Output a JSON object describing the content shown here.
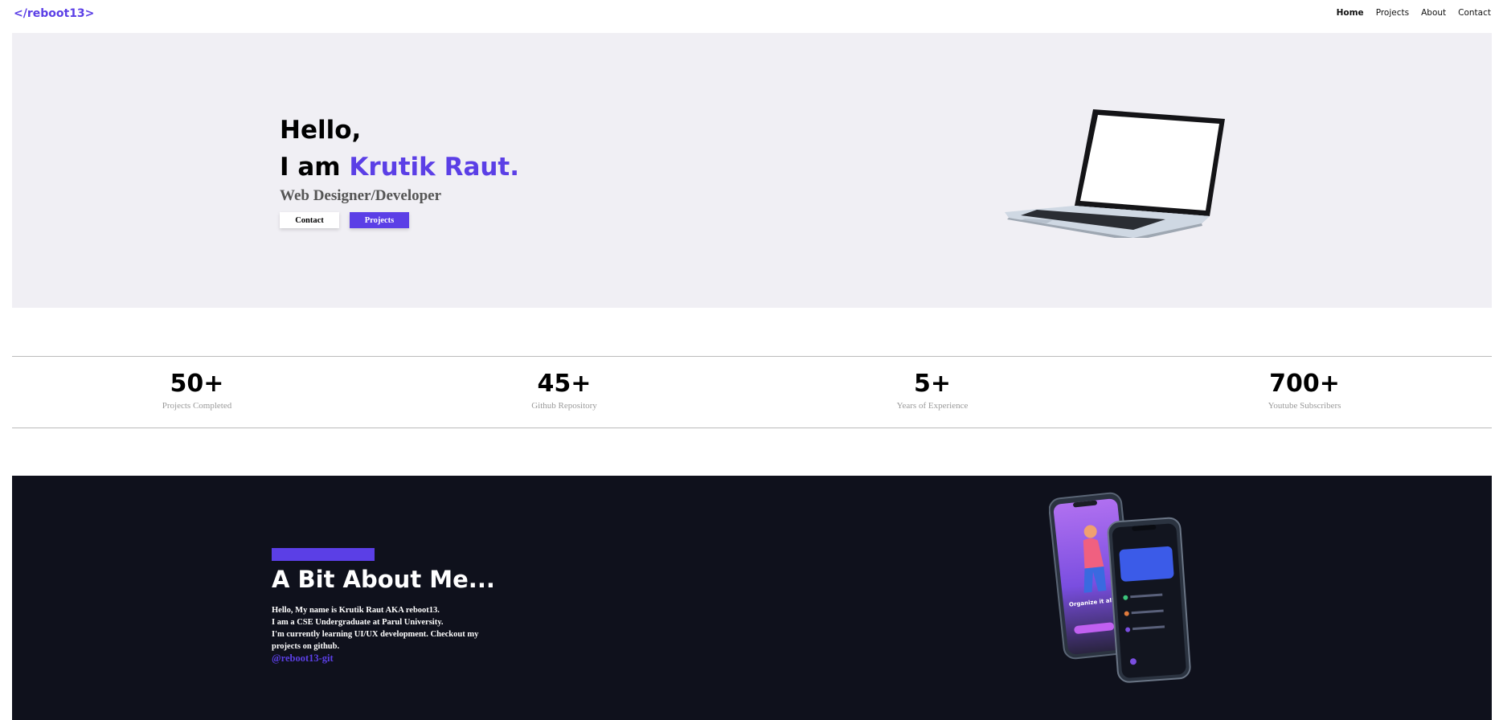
{
  "nav": {
    "logo": "</reboot13>",
    "links": [
      "Home",
      "Projects",
      "About",
      "Contact"
    ]
  },
  "hero": {
    "greeting": "Hello,",
    "intro_prefix": "I am ",
    "name": "Krutik Raut.",
    "role": "Web Designer/Developer",
    "buttons": {
      "contact": "Contact",
      "projects": "Projects"
    },
    "image_icon": "laptop-illustration"
  },
  "stats": [
    {
      "value": "50+",
      "label": "Projects Completed"
    },
    {
      "value": "45+",
      "label": "Github Repository"
    },
    {
      "value": "5+",
      "label": "Years of Experience"
    },
    {
      "value": "700+",
      "label": "Youtube Subscribers"
    }
  ],
  "about": {
    "title": "A Bit About Me...",
    "lines": [
      "Hello, My name is Krutik Raut AKA reboot13.",
      "I am a CSE Undergraduate at Parul University.",
      "I'm currently learning UI/UX development. Checkout my projects on github."
    ],
    "link": "@reboot13-git",
    "phone_screen_text": "Organize it all with Estero",
    "image_icon": "phones-illustration"
  },
  "colors": {
    "accent": "#5b3fe6",
    "hero_bg": "#f0eff4",
    "about_bg": "#0f111c"
  }
}
